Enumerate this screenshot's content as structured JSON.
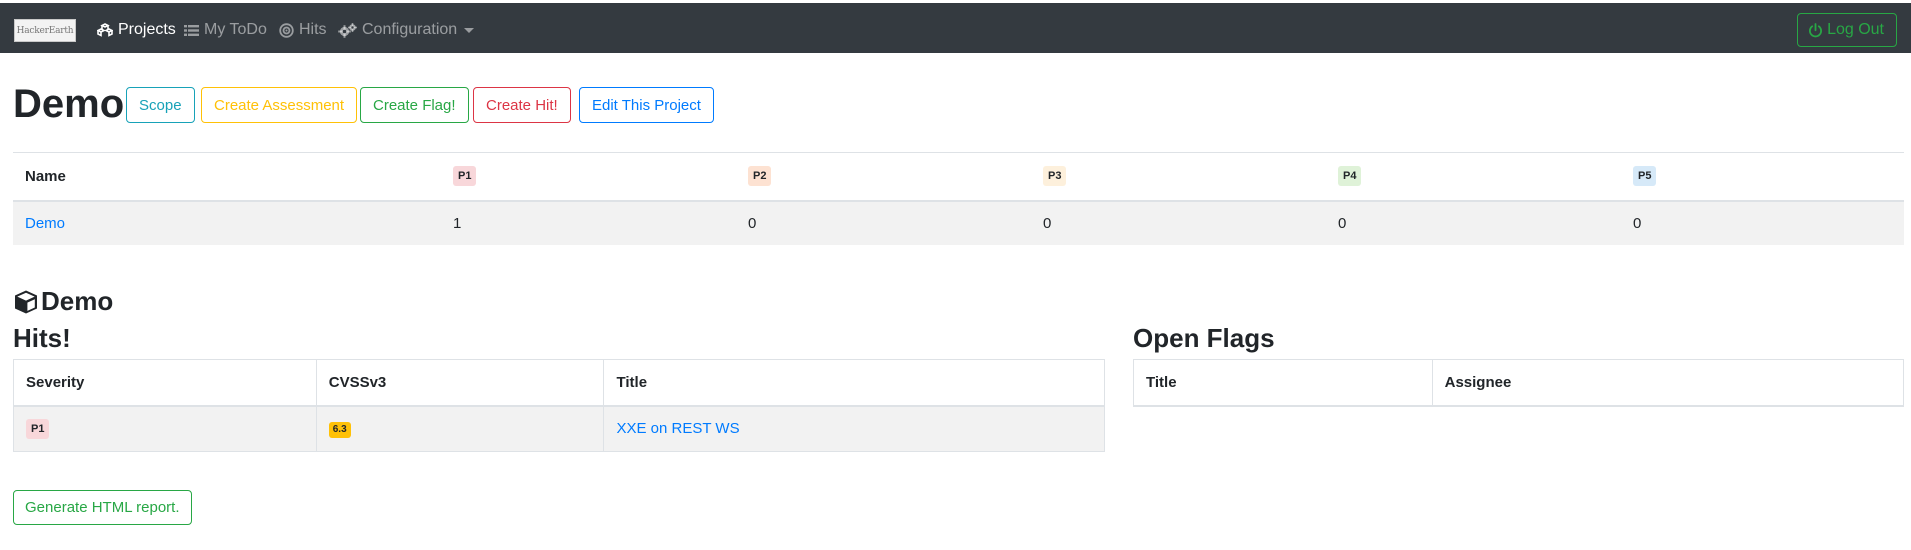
{
  "nav": {
    "logo_text": "HackerEarth",
    "projects": "Projects",
    "todo": "My ToDo",
    "hits": "Hits",
    "configuration": "Configuration",
    "logout": "Log Out"
  },
  "project": {
    "title": "Demo",
    "buttons": {
      "scope": "Scope",
      "create_assessment": "Create Assessment",
      "create_flag": "Create Flag!",
      "create_hit": "Create Hit!",
      "edit_project": "Edit This Project"
    }
  },
  "summary": {
    "headers": [
      "Name",
      "P1",
      "P2",
      "P3",
      "P4",
      "P5"
    ],
    "badge_colors": [
      "#f8d7da",
      "#fde2d2",
      "#fdf0dc",
      "#dff2d8",
      "#d6e9f8"
    ],
    "row": {
      "name": "Demo",
      "p1": "1",
      "p2": "0",
      "p3": "0",
      "p4": "0",
      "p5": "0"
    }
  },
  "section": {
    "title": "Demo",
    "hits_heading": "Hits!",
    "flags_heading": "Open Flags"
  },
  "hits_table": {
    "headers": [
      "Severity",
      "CVSSv3",
      "Title"
    ],
    "rows": [
      {
        "severity": "P1",
        "cvss": "6.3",
        "title": "XXE on REST WS"
      }
    ]
  },
  "flags_table": {
    "headers": [
      "Title",
      "Assignee"
    ],
    "rows": []
  },
  "report_button": "Generate HTML report."
}
